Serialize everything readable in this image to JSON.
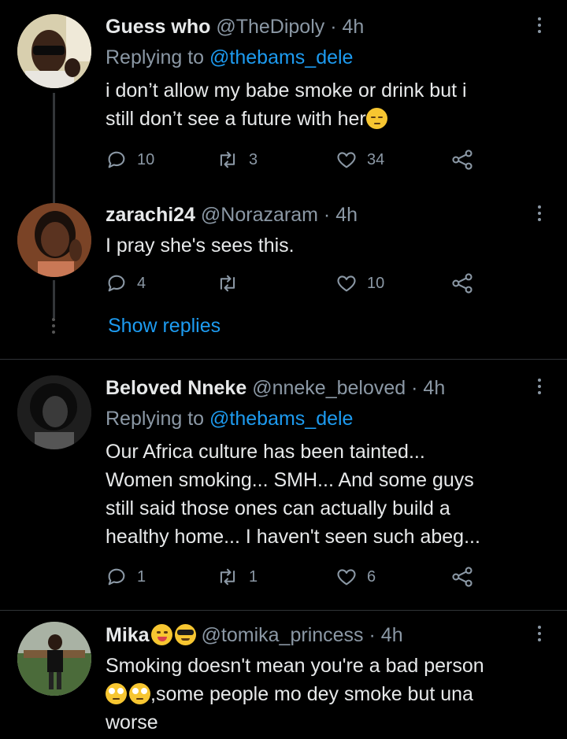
{
  "tweets": [
    {
      "name": "Guess who",
      "handle": "@TheDipoly",
      "time": "4h",
      "replying_prefix": "Replying to",
      "replying_to": "@thebams_dele",
      "text_lines": [
        "i don’t allow my babe smoke or drink but i",
        "still don’t see a future with her"
      ],
      "replies": "10",
      "retweets": "3",
      "likes": "34"
    },
    {
      "name": "zarachi24",
      "handle": "@Norazaram",
      "time": "4h",
      "text_lines": [
        "I pray she's sees this."
      ],
      "replies": "4",
      "retweets": "",
      "likes": "10"
    },
    {
      "name": "Beloved Nneke",
      "handle": "@nneke_beloved",
      "time": "4h",
      "replying_prefix": "Replying to",
      "replying_to": "@thebams_dele",
      "text_lines": [
        "Our Africa culture has been tainted...",
        "Women smoking... SMH... And some guys",
        "still said those ones can actually build a",
        "healthy home... I haven't seen such abeg..."
      ],
      "replies": "1",
      "retweets": "1",
      "likes": "6"
    },
    {
      "name": "Mika",
      "handle": "@tomika_princess",
      "time": "4h",
      "text_lines": [
        "Smoking doesn't mean you're a bad person",
        ",some people mo dey smoke but una",
        "worse"
      ]
    }
  ],
  "show_replies": "Show replies",
  "dot_separator": "·",
  "colors": {
    "background": "#000000",
    "text": "#e7e9ea",
    "muted": "#8b98a5",
    "link": "#1d9bf0"
  },
  "icons": [
    "reply-icon",
    "retweet-icon",
    "like-icon",
    "share-icon",
    "more-options-icon"
  ]
}
